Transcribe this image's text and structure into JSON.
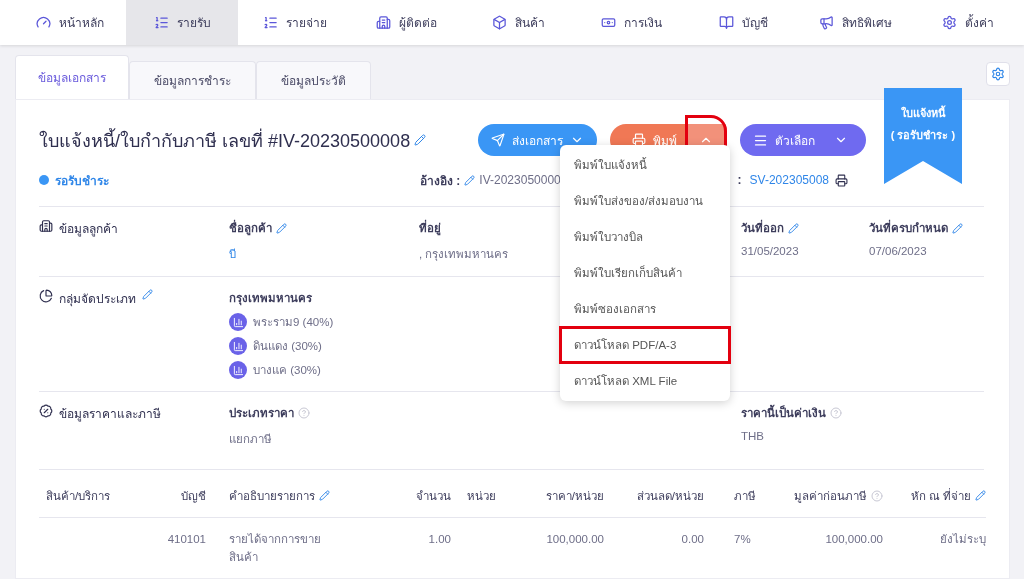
{
  "nav": [
    {
      "label": "หน้าหลัก",
      "selected": false
    },
    {
      "label": "รายรับ",
      "selected": true
    },
    {
      "label": "รายจ่าย",
      "selected": false
    },
    {
      "label": "ผู้ติดต่อ",
      "selected": false
    },
    {
      "label": "สินค้า",
      "selected": false
    },
    {
      "label": "การเงิน",
      "selected": false
    },
    {
      "label": "บัญชี",
      "selected": false
    },
    {
      "label": "สิทธิพิเศษ",
      "selected": false
    },
    {
      "label": "ตั้งค่า",
      "selected": false
    }
  ],
  "tabs": [
    {
      "label": "ข้อมูลเอกสาร",
      "selected": true
    },
    {
      "label": "ข้อมูลการชำระ",
      "selected": false
    },
    {
      "label": "ข้อมูลประวัติ",
      "selected": false
    }
  ],
  "document": {
    "title": "ใบแจ้งหนี้/ใบกำกับภาษี เลขที่ #IV-20230500008",
    "status": "รอรับชำระ",
    "reference_label": "อ้างอิง :",
    "reference_value": "IV-2023050000",
    "reference2_label": ":",
    "reference2_value": "SV-202305008"
  },
  "actions": {
    "send": "ส่งเอกสาร",
    "print": "พิมพ์",
    "print_toggle_highlighted": true,
    "options": "ตัวเลือก"
  },
  "print_menu": {
    "expanded": true,
    "items": [
      {
        "label": "พิมพ์ใบแจ้งหนี้",
        "highlighted": false
      },
      {
        "label": "พิมพ์ใบส่งของ/ส่งมอบงาน",
        "highlighted": false
      },
      {
        "label": "พิมพ์ใบวางบิล",
        "highlighted": false
      },
      {
        "label": "พิมพ์ใบเรียกเก็บสินค้า",
        "highlighted": false
      },
      {
        "label": "พิมพ์ซองเอกสาร",
        "highlighted": false
      },
      {
        "label": "ดาวน์โหลด PDF/A-3",
        "highlighted": true
      },
      {
        "label": "ดาวน์โหลด XML File",
        "highlighted": false
      }
    ]
  },
  "ribbon": {
    "title": "ใบแจ้งหนี้",
    "status": "( รอรับชำระ )"
  },
  "customer": {
    "section": "ข้อมูลลูกค้า",
    "fields": [
      {
        "label": "ชื่อลูกค้า",
        "value": "บี",
        "editable": true,
        "kind": "link"
      },
      {
        "label": "ที่อยู่",
        "value": ", กรุงเทพมหานคร",
        "editable": false,
        "kind": "text"
      },
      {
        "label": "วันที่ออก",
        "value": "31/05/2023",
        "editable": true,
        "kind": "text"
      },
      {
        "label": "วันที่ครบกำหนด",
        "value": "07/06/2023",
        "editable": true,
        "kind": "text"
      }
    ]
  },
  "category": {
    "section": "กลุ่มจัดประเภท",
    "editable": true,
    "group": "กรุงเทพมหานคร",
    "items": [
      "พระราม9 (40%)",
      "ดินแดง (30%)",
      "บางแค (30%)"
    ]
  },
  "pricing": {
    "section": "ข้อมูลราคาและภาษี",
    "fields": [
      {
        "label": "ประเภทราคา",
        "value": "แยกภาษี",
        "help": true
      },
      {
        "label": "ราคานี้เป็นค่าเงิน",
        "value": "THB",
        "help": true
      }
    ]
  },
  "table": {
    "columns": [
      {
        "label": "สินค้า/บริการ"
      },
      {
        "label": "บัญชี"
      },
      {
        "label": "คำอธิบายรายการ",
        "editable": true
      },
      {
        "label": "จำนวน"
      },
      {
        "label": "หน่วย"
      },
      {
        "label": "ราคา/หน่วย"
      },
      {
        "label": "ส่วนลด/หน่วย"
      },
      {
        "label": "ภาษี"
      },
      {
        "label": "มูลค่าก่อนภาษี",
        "help": true
      },
      {
        "label": "หัก ณ ที่จ่าย",
        "editable": true
      }
    ],
    "rows": [
      {
        "cells": [
          null,
          "410101",
          "รายได้จากการขายสินค้า",
          "1.00",
          null,
          "100,000.00",
          "0.00",
          "7%",
          "100,000.00",
          "ยังไม่ระบุ"
        ]
      }
    ]
  }
}
